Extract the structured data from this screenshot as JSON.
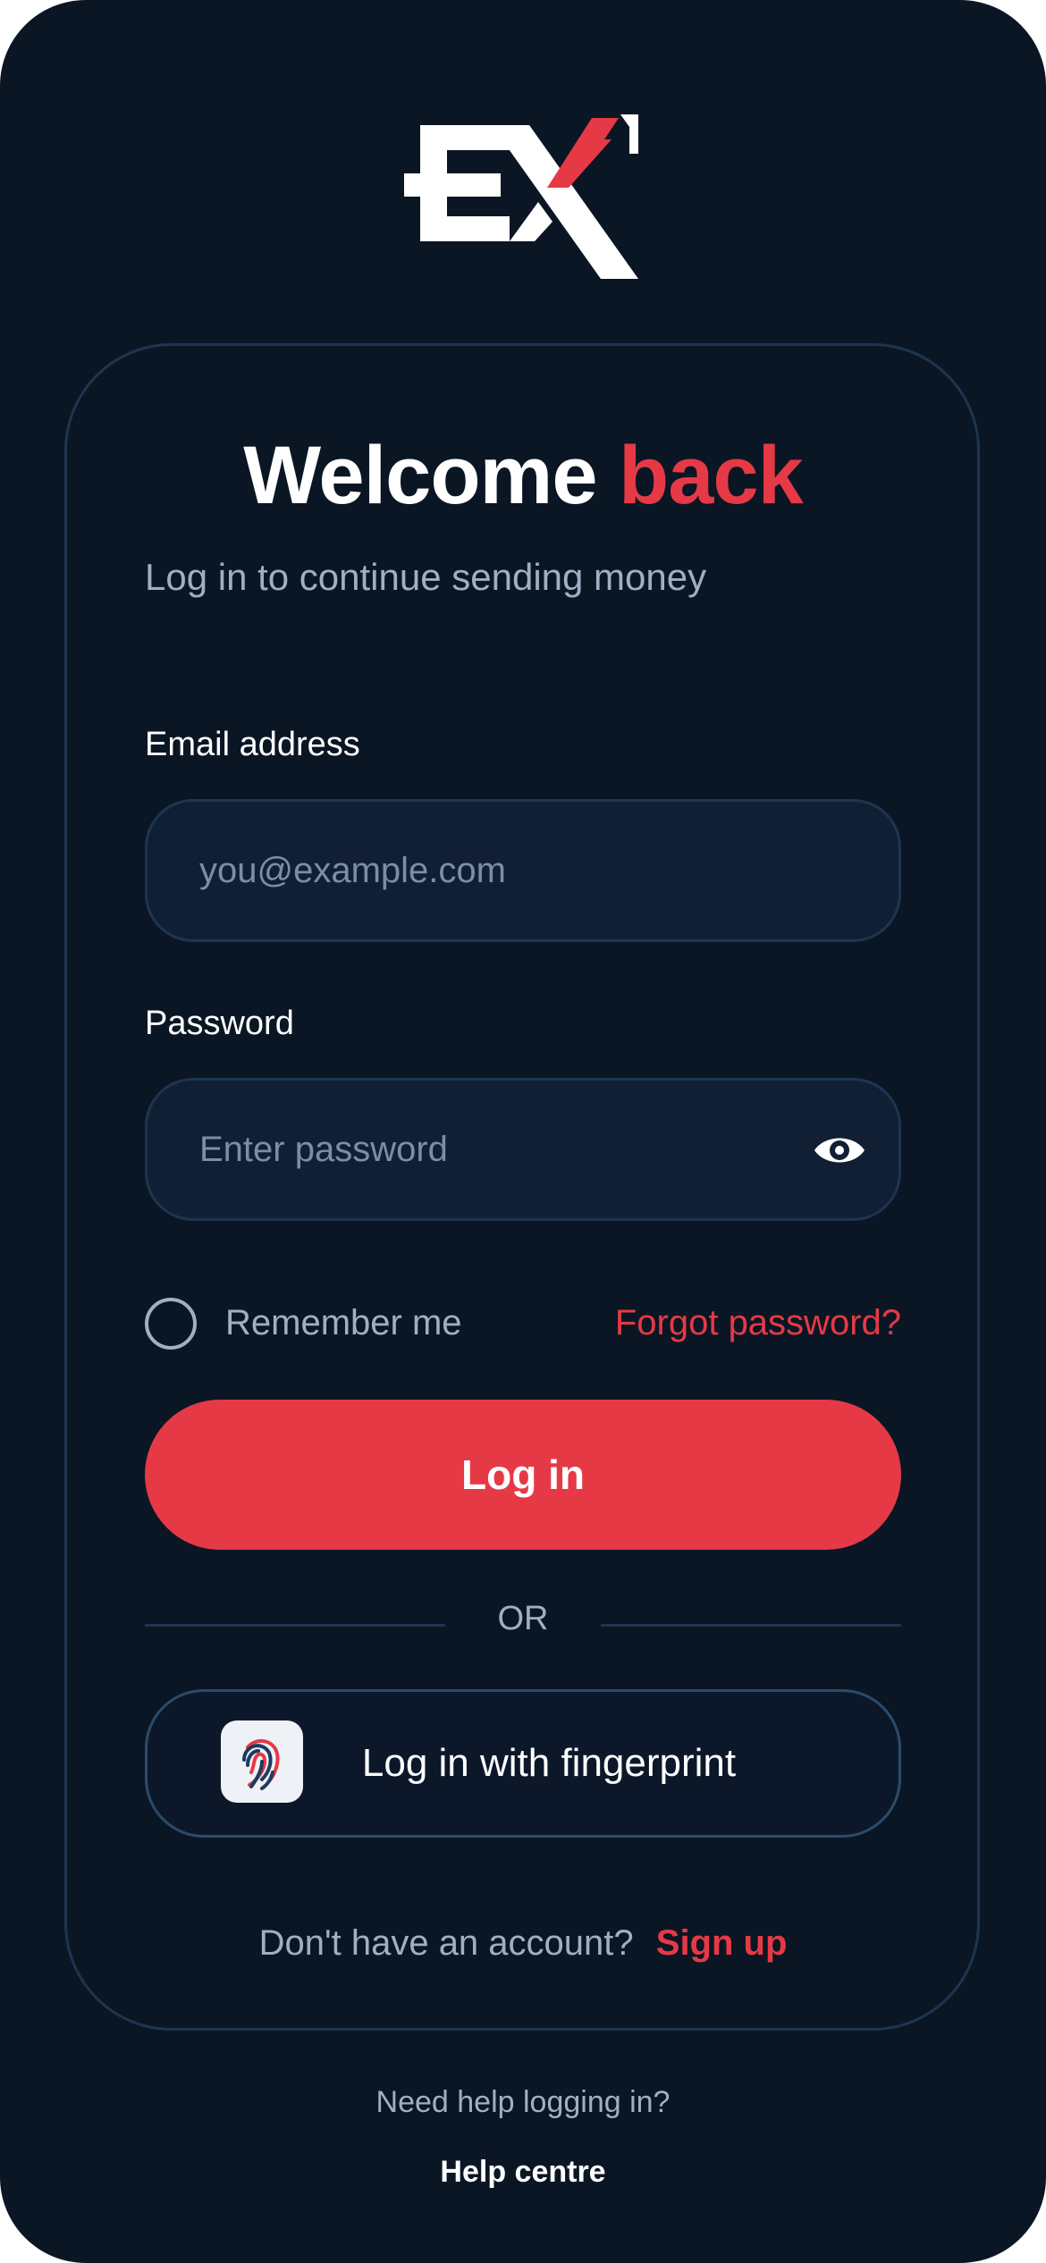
{
  "brand": {
    "logo_text": "EX",
    "colors": {
      "background": "#0a1624",
      "accent": "#e63946",
      "field": "#111f35",
      "muted": "#9fb0c4"
    }
  },
  "header": {
    "title_main": "Welcome",
    "title_accent": "back",
    "subtitle": "Log in to continue sending money"
  },
  "form": {
    "email_label": "Email address",
    "email_placeholder": "you@example.com",
    "password_label": "Password",
    "password_placeholder": "Enter password",
    "remember_label": "Remember me",
    "remember_checked": false,
    "forgot_link": "Forgot password?",
    "login_button": "Log in"
  },
  "divider": {
    "text": "OR"
  },
  "fingerprint": {
    "label": "Log in with fingerprint",
    "icon": "fingerprint-icon"
  },
  "signup": {
    "question": "Don't have an account?",
    "link": "Sign up"
  },
  "help": {
    "question": "Need help logging in?",
    "link": "Help centre"
  }
}
